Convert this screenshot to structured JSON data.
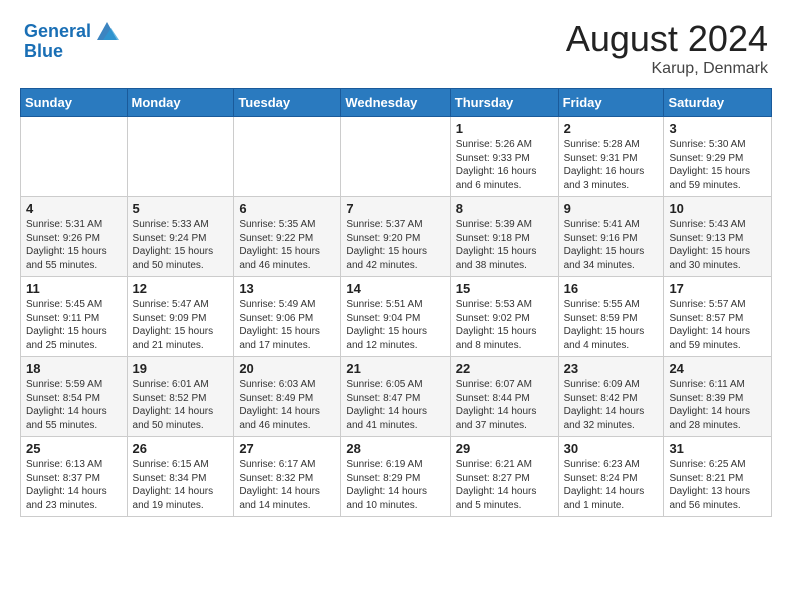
{
  "header": {
    "logo_line1": "General",
    "logo_line2": "Blue",
    "month_year": "August 2024",
    "location": "Karup, Denmark"
  },
  "days_of_week": [
    "Sunday",
    "Monday",
    "Tuesday",
    "Wednesday",
    "Thursday",
    "Friday",
    "Saturday"
  ],
  "weeks": [
    [
      {
        "day": "",
        "info": ""
      },
      {
        "day": "",
        "info": ""
      },
      {
        "day": "",
        "info": ""
      },
      {
        "day": "",
        "info": ""
      },
      {
        "day": "1",
        "info": "Sunrise: 5:26 AM\nSunset: 9:33 PM\nDaylight: 16 hours\nand 6 minutes."
      },
      {
        "day": "2",
        "info": "Sunrise: 5:28 AM\nSunset: 9:31 PM\nDaylight: 16 hours\nand 3 minutes."
      },
      {
        "day": "3",
        "info": "Sunrise: 5:30 AM\nSunset: 9:29 PM\nDaylight: 15 hours\nand 59 minutes."
      }
    ],
    [
      {
        "day": "4",
        "info": "Sunrise: 5:31 AM\nSunset: 9:26 PM\nDaylight: 15 hours\nand 55 minutes."
      },
      {
        "day": "5",
        "info": "Sunrise: 5:33 AM\nSunset: 9:24 PM\nDaylight: 15 hours\nand 50 minutes."
      },
      {
        "day": "6",
        "info": "Sunrise: 5:35 AM\nSunset: 9:22 PM\nDaylight: 15 hours\nand 46 minutes."
      },
      {
        "day": "7",
        "info": "Sunrise: 5:37 AM\nSunset: 9:20 PM\nDaylight: 15 hours\nand 42 minutes."
      },
      {
        "day": "8",
        "info": "Sunrise: 5:39 AM\nSunset: 9:18 PM\nDaylight: 15 hours\nand 38 minutes."
      },
      {
        "day": "9",
        "info": "Sunrise: 5:41 AM\nSunset: 9:16 PM\nDaylight: 15 hours\nand 34 minutes."
      },
      {
        "day": "10",
        "info": "Sunrise: 5:43 AM\nSunset: 9:13 PM\nDaylight: 15 hours\nand 30 minutes."
      }
    ],
    [
      {
        "day": "11",
        "info": "Sunrise: 5:45 AM\nSunset: 9:11 PM\nDaylight: 15 hours\nand 25 minutes."
      },
      {
        "day": "12",
        "info": "Sunrise: 5:47 AM\nSunset: 9:09 PM\nDaylight: 15 hours\nand 21 minutes."
      },
      {
        "day": "13",
        "info": "Sunrise: 5:49 AM\nSunset: 9:06 PM\nDaylight: 15 hours\nand 17 minutes."
      },
      {
        "day": "14",
        "info": "Sunrise: 5:51 AM\nSunset: 9:04 PM\nDaylight: 15 hours\nand 12 minutes."
      },
      {
        "day": "15",
        "info": "Sunrise: 5:53 AM\nSunset: 9:02 PM\nDaylight: 15 hours\nand 8 minutes."
      },
      {
        "day": "16",
        "info": "Sunrise: 5:55 AM\nSunset: 8:59 PM\nDaylight: 15 hours\nand 4 minutes."
      },
      {
        "day": "17",
        "info": "Sunrise: 5:57 AM\nSunset: 8:57 PM\nDaylight: 14 hours\nand 59 minutes."
      }
    ],
    [
      {
        "day": "18",
        "info": "Sunrise: 5:59 AM\nSunset: 8:54 PM\nDaylight: 14 hours\nand 55 minutes."
      },
      {
        "day": "19",
        "info": "Sunrise: 6:01 AM\nSunset: 8:52 PM\nDaylight: 14 hours\nand 50 minutes."
      },
      {
        "day": "20",
        "info": "Sunrise: 6:03 AM\nSunset: 8:49 PM\nDaylight: 14 hours\nand 46 minutes."
      },
      {
        "day": "21",
        "info": "Sunrise: 6:05 AM\nSunset: 8:47 PM\nDaylight: 14 hours\nand 41 minutes."
      },
      {
        "day": "22",
        "info": "Sunrise: 6:07 AM\nSunset: 8:44 PM\nDaylight: 14 hours\nand 37 minutes."
      },
      {
        "day": "23",
        "info": "Sunrise: 6:09 AM\nSunset: 8:42 PM\nDaylight: 14 hours\nand 32 minutes."
      },
      {
        "day": "24",
        "info": "Sunrise: 6:11 AM\nSunset: 8:39 PM\nDaylight: 14 hours\nand 28 minutes."
      }
    ],
    [
      {
        "day": "25",
        "info": "Sunrise: 6:13 AM\nSunset: 8:37 PM\nDaylight: 14 hours\nand 23 minutes."
      },
      {
        "day": "26",
        "info": "Sunrise: 6:15 AM\nSunset: 8:34 PM\nDaylight: 14 hours\nand 19 minutes."
      },
      {
        "day": "27",
        "info": "Sunrise: 6:17 AM\nSunset: 8:32 PM\nDaylight: 14 hours\nand 14 minutes."
      },
      {
        "day": "28",
        "info": "Sunrise: 6:19 AM\nSunset: 8:29 PM\nDaylight: 14 hours\nand 10 minutes."
      },
      {
        "day": "29",
        "info": "Sunrise: 6:21 AM\nSunset: 8:27 PM\nDaylight: 14 hours\nand 5 minutes."
      },
      {
        "day": "30",
        "info": "Sunrise: 6:23 AM\nSunset: 8:24 PM\nDaylight: 14 hours\nand 1 minute."
      },
      {
        "day": "31",
        "info": "Sunrise: 6:25 AM\nSunset: 8:21 PM\nDaylight: 13 hours\nand 56 minutes."
      }
    ]
  ]
}
